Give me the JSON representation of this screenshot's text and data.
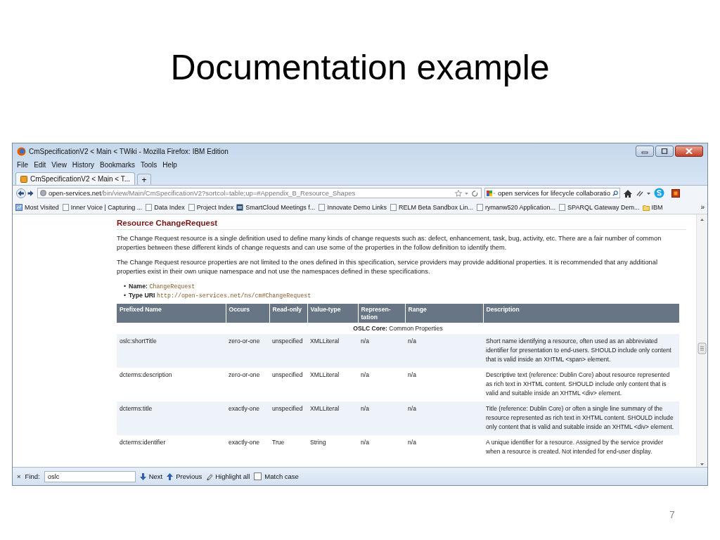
{
  "slide": {
    "title": "Documentation example",
    "page_number": "7"
  },
  "window": {
    "title": "CmSpecificationV2 < Main < TWiki - Mozilla Firefox: IBM Edition"
  },
  "menu": [
    "File",
    "Edit",
    "View",
    "History",
    "Bookmarks",
    "Tools",
    "Help"
  ],
  "tabs": [
    {
      "label": "CmSpecificationV2 < Main < T...",
      "selected": true
    }
  ],
  "new_tab": "+",
  "address": {
    "domain": "open-services.net",
    "path": "/bin/view/Main/CmSpecificationV2?sortcol=table;up=#Appendix_B_Resource_Shapes"
  },
  "search": {
    "value": "open services for lifecycle collaboratio"
  },
  "bookmarks": [
    {
      "label": "Most Visited",
      "kind": "smart"
    },
    {
      "label": "Inner Voice | Capturing ...",
      "kind": "page"
    },
    {
      "label": "Data Index",
      "kind": "page"
    },
    {
      "label": "Project Index",
      "kind": "page"
    },
    {
      "label": "SmartCloud Meetings f...",
      "kind": "app"
    },
    {
      "label": "Innovate Demo Links",
      "kind": "page"
    },
    {
      "label": "RELM Beta Sandbox Lin...",
      "kind": "page"
    },
    {
      "label": "rymanw520 Application...",
      "kind": "page"
    },
    {
      "label": "SPARQL Gateway Dem...",
      "kind": "page"
    },
    {
      "label": "IBM",
      "kind": "folder"
    }
  ],
  "bookmarks_overflow": "»",
  "page": {
    "heading": "Resource ChangeRequest",
    "paragraphs": [
      "The Change Request resource is a single definition used to define many kinds of change requests such as: defect, enhancement, task, bug, activity, etc. There are a fair number of common properties between these different kinds of change requests and can use some of the properties in the follow definition to identify them.",
      "The Change Request resource properties are not limited to the ones defined in this specification, service providers may provide additional properties. It is recommended that any additional properties exist in their own unique namespace and not use the namespaces defined in these specifications."
    ],
    "properties": [
      {
        "bullet": "•",
        "label": "Name:",
        "value": "ChangeRequest"
      },
      {
        "bullet": "•",
        "label": "Type URI",
        "value": "http://open-services.net/ns/cm#ChangeRequest"
      }
    ]
  },
  "table": {
    "columns": [
      "Prefixed Name",
      "Occurs",
      "Read-only",
      "Value-type",
      "Represen-tation",
      "Range",
      "Description"
    ],
    "section": "**OSLC Core:** Common Properties",
    "rows": [
      {
        "cells": [
          "oslc:shortTitle",
          "zero-or-one",
          "unspecified",
          "XMLLiteral",
          "n/a",
          "n/a",
          "Short name identifying a resource, often used as an abbreviated identifier for presentation to end-users. SHOULD include only content that is valid inside an XHTML <span> element."
        ]
      },
      {
        "cells": [
          "dcterms:description",
          "zero-or-one",
          "unspecified",
          "XMLLiteral",
          "n/a",
          "n/a",
          "Descriptive text (reference: Dublin Core) about resource represented as rich text in XHTML content. SHOULD include only content that is valid and suitable inside an XHTML <div> element."
        ]
      },
      {
        "cells": [
          "dcterms:title",
          "exactly-one",
          "unspecified",
          "XMLLiteral",
          "n/a",
          "n/a",
          "Title (reference: Dublin Core) or often a single line summary of the resource represented as rich text in XHTML content. SHOULD include only content that is valid and suitable inside an XHTML <div> element."
        ]
      },
      {
        "cells": [
          "dcterms:identifier",
          "exactly-one",
          "True",
          "String",
          "n/a",
          "n/a",
          "A unique identifier for a resource. Assigned by the service provider when a resource is created. Not intended for end-user display."
        ]
      }
    ]
  },
  "find_bar": {
    "close": "×",
    "label": "Find:",
    "value": "oslc",
    "buttons": [
      {
        "label": "Next",
        "kind": "down"
      },
      {
        "label": "Previous",
        "kind": "up"
      },
      {
        "label": "Highlight all",
        "kind": "marker"
      }
    ],
    "match_case": {
      "label": "Match case",
      "checked": false
    }
  }
}
